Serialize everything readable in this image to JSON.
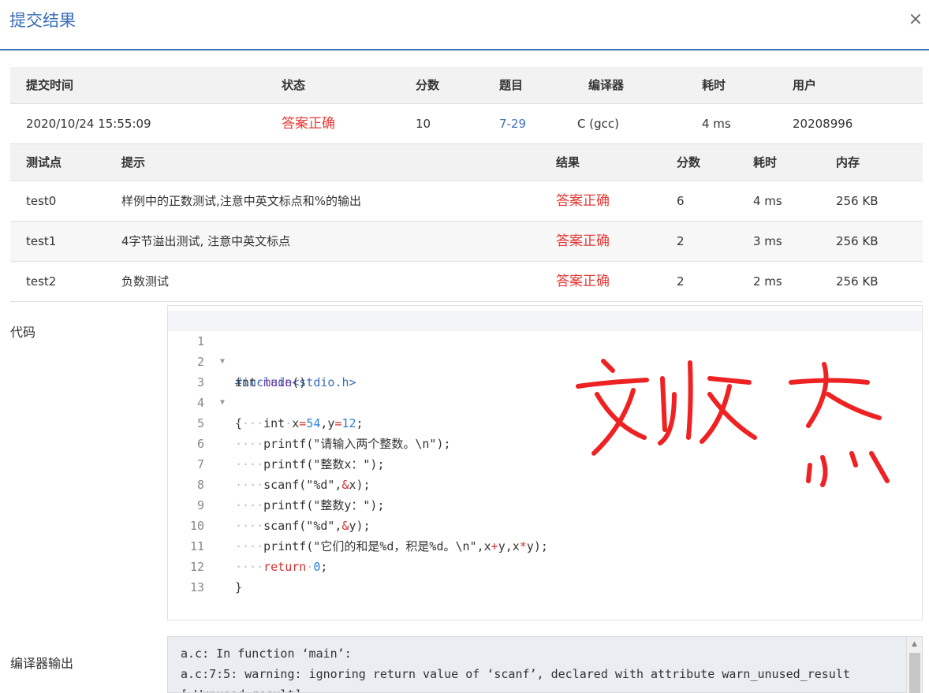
{
  "modal": {
    "title": "提交结果",
    "close_glyph": "×"
  },
  "summary": {
    "headers": [
      "提交时间",
      "状态",
      "分数",
      "题目",
      "编译器",
      "耗时",
      "用户"
    ],
    "row": [
      "2020/10/24 15:55:09",
      "答案正确",
      "10",
      "7-29",
      "C (gcc)",
      "4 ms",
      "20208996"
    ]
  },
  "tests": {
    "headers": [
      "测试点",
      "提示",
      "结果",
      "分数",
      "耗时",
      "内存"
    ],
    "rows": [
      [
        "test0",
        "样例中的正数测试,注意中英文标点和%的输出",
        "答案正确",
        "6",
        "4 ms",
        "256 KB"
      ],
      [
        "test1",
        "4字节溢出测试, 注意中英文标点",
        "答案正确",
        "2",
        "3 ms",
        "256 KB"
      ],
      [
        "test2",
        "负数测试",
        "答案正确",
        "2",
        "2 ms",
        "256 KB"
      ]
    ]
  },
  "code": {
    "label": "代码",
    "line_numbers": [
      "1",
      "2",
      "3",
      "4",
      "5",
      "6",
      "7",
      "8",
      "9",
      "10",
      "11",
      "12",
      "13"
    ],
    "lines": {
      "l1": "#include<stdio.h>",
      "l2a": "int",
      "l2b": "main",
      "l2c": "()",
      "l3": "{",
      "l4a": "int",
      "l4b": "x",
      "l4c": "=",
      "l4d": "54",
      "l4e": ",y",
      "l4f": "=",
      "l4g": "12",
      "l4h": ";",
      "l5a": "printf",
      "l5b": "(\"请输入两个整数。\\n\");",
      "l6a": "printf",
      "l6b": "(\"整数x：\");",
      "l7a": "scanf",
      "l7b": "(\"%d\",",
      "l7c": "&",
      "l7d": "x);",
      "l8a": "printf",
      "l8b": "(\"整数y：\");",
      "l9a": "scanf",
      "l9b": "(\"%d\",",
      "l9c": "&",
      "l9d": "y);",
      "l10a": "printf",
      "l10b": "(\"它们的和是%d，积是%d。\\n\",x",
      "l10c": "+",
      "l10d": "y,x",
      "l10e": "*",
      "l10f": "y);",
      "l11a": "return",
      "l11b": "0",
      "l11c": ";",
      "l12": "}"
    }
  },
  "compiler_output": {
    "label": "编译器输出",
    "lines": [
      "a.c: In function ‘main’:",
      "a.c:7:5: warning: ignoring return value of ‘scanf’, declared with attribute warn_unused_result",
      "[-Wunused-result]"
    ]
  },
  "colors": {
    "accent": "#3a6fb7",
    "correct": "#e53935",
    "signature": "#ee2222"
  }
}
